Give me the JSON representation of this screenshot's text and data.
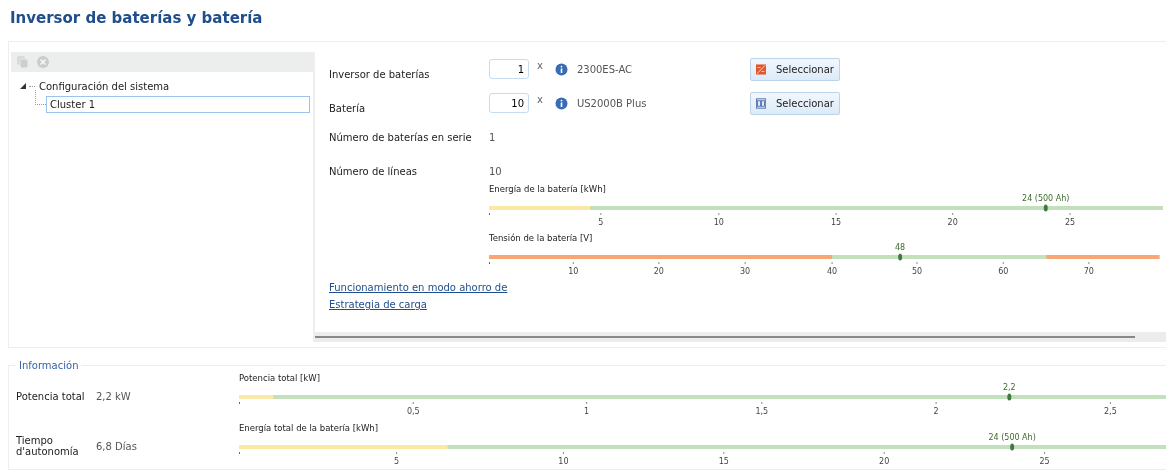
{
  "title": "Inversor de baterías y batería",
  "tree": {
    "toolbar": [
      {
        "kind": "copy",
        "disabled": true
      },
      {
        "kind": "delete",
        "disabled": true
      }
    ],
    "items": [
      {
        "label": "Configuración del sistema",
        "expanded": true,
        "selected": false,
        "children": [
          {
            "label": "Cluster 1",
            "selected": true
          }
        ]
      }
    ]
  },
  "devices": [
    {
      "kind": "inverter",
      "label": "Inversor de baterías",
      "count": "1",
      "multiplier": "x",
      "model": "2300ES-AC",
      "button": "Seleccionar"
    },
    {
      "kind": "battery",
      "label": "Batería",
      "count": "10",
      "multiplier": "x",
      "model": "US2000B Plus",
      "button": "Seleccionar"
    }
  ],
  "info_rows": [
    {
      "label": "Número de baterías en serie",
      "value": "1"
    },
    {
      "label": "Número de líneas",
      "value": "10"
    }
  ],
  "scales": [
    {
      "title": "Energía de la batería [kWh]",
      "zones": [
        {
          "color": "#fbe8a6",
          "level": 0.15
        },
        {
          "color": "#c3e0bc",
          "level": 1
        }
      ],
      "ticks": [
        {
          "label": "5",
          "level": 0.166
        },
        {
          "label": "10",
          "level": 0.341
        },
        {
          "label": "15",
          "level": 0.515
        },
        {
          "label": "20",
          "level": 0.688
        },
        {
          "label": "25",
          "level": 0.862
        }
      ],
      "marker": {
        "label": "24 (500 Ah)",
        "level": 0.826
      }
    },
    {
      "title": "Tensión de la batería [V]",
      "zones": [
        {
          "color": "#f9a677",
          "level": 0.509
        },
        {
          "color": "#c3e0bc",
          "level": 0.827
        },
        {
          "color": "#f9a677",
          "level": 0.995
        }
      ],
      "ticks": [
        {
          "label": "10",
          "level": 0.125
        },
        {
          "label": "20",
          "level": 0.252
        },
        {
          "label": "30",
          "level": 0.38
        },
        {
          "label": "40",
          "level": 0.509
        },
        {
          "label": "50",
          "level": 0.635
        },
        {
          "label": "60",
          "level": 0.763
        },
        {
          "label": "70",
          "level": 0.89
        }
      ],
      "marker": {
        "label": "48",
        "level": 0.61
      }
    }
  ],
  "links": [
    "Funcionamiento en modo ahorro de",
    "Estrategia de carga"
  ],
  "information": {
    "legend": "Información",
    "rows": [
      {
        "label": "Potencia total",
        "value": "2,2 kW",
        "scale": {
          "title": "Potencia total [kW]",
          "zones": [
            {
              "color": "#fbe8a6",
              "level": 0.037
            },
            {
              "color": "#c3e0bc",
              "level": 1
            }
          ],
          "ticks": [
            {
              "label": "0,5",
              "level": 0.188
            },
            {
              "label": "1",
              "level": 0.375
            },
            {
              "label": "1,5",
              "level": 0.564
            },
            {
              "label": "2",
              "level": 0.752
            },
            {
              "label": "2,5",
              "level": 0.94
            }
          ],
          "marker": {
            "label": "2,2",
            "level": 0.831
          }
        }
      },
      {
        "label": "Tiempo d'autonomía",
        "value": "6,8 Días",
        "scale": {
          "title": "Energía total de la batería [kWh]",
          "zones": [
            {
              "color": "#fbe8a6",
              "level": 0.225
            },
            {
              "color": "#c3e0bc",
              "level": 1
            }
          ],
          "ticks": [
            {
              "label": "5",
              "level": 0.17
            },
            {
              "label": "10",
              "level": 0.35
            },
            {
              "label": "15",
              "level": 0.523
            },
            {
              "label": "20",
              "level": 0.696
            },
            {
              "label": "25",
              "level": 0.869
            }
          ],
          "marker": {
            "label": "24 (500 Ah)",
            "level": 0.834
          }
        }
      }
    ]
  }
}
